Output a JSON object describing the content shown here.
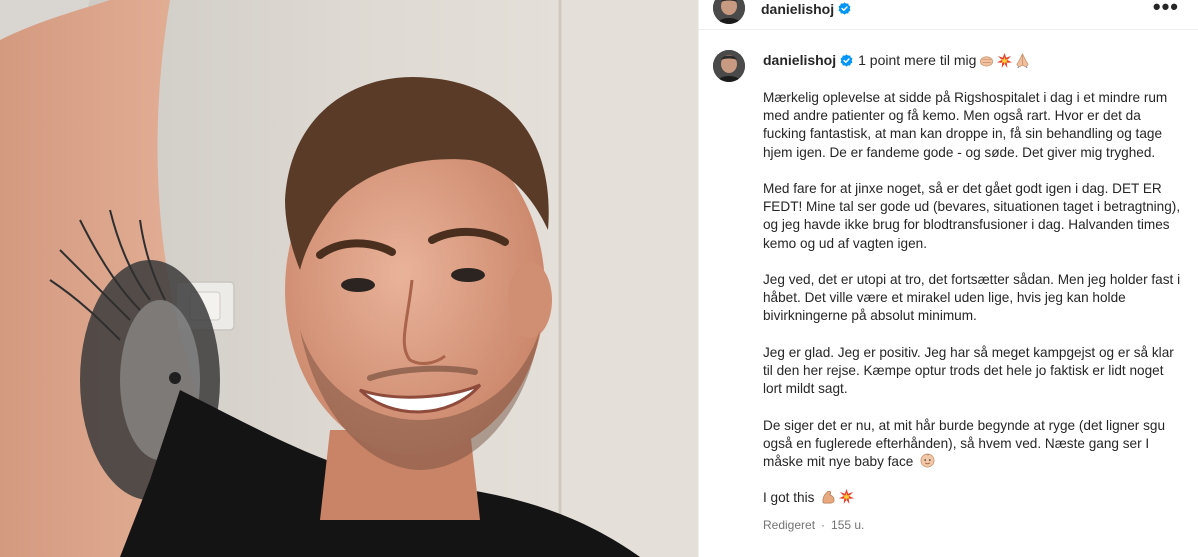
{
  "post": {
    "username": "danielishoj",
    "verified": true,
    "title": "1 point mere til mig",
    "title_emojis": [
      "oncoming-fist",
      "collision",
      "folded-hands"
    ],
    "more_label": "•••",
    "caption": [
      "Mærkelig oplevelse at sidde på Rigshospitalet i dag i et mindre rum med andre patienter og få kemo. Men også rart. Hvor er det da fucking fantastisk, at man kan droppe in, få sin behandling og tage hjem igen. De er fandeme gode - og søde. Det giver mig tryghed.",
      "Med fare for at jinxe noget, så er det gået godt igen i dag. DET ER FEDT! Mine tal ser gode ud (bevares, situationen taget i betragtning), og jeg havde ikke brug for blodtransfusioner i dag. Halvanden times kemo og ud af vagten igen.",
      "Jeg ved, det er utopi at tro, det fortsætter sådan. Men jeg holder fast i håbet. Det ville være et mirakel uden lige, hvis jeg kan holde bivirkningerne på absolut minimum.",
      "Jeg er glad. Jeg er positiv. Jeg har så meget kampgejst og er så klar til den her rejse. Kæmpe optur trods det hele jo faktisk er lidt noget lort mildt sagt.",
      "De siger det er nu, at mit hår burde begynde at ryge (det ligner sgu også en fuglerede efterhånden), så hvem ved. Næste gang ser I måske mit nye baby face",
      "I got this"
    ],
    "edited_label": "Redigeret",
    "separator": "·",
    "age": "155 u."
  },
  "colors": {
    "verified_blue": "#0095f6",
    "meta_gray": "#737373",
    "text": "#262626"
  }
}
